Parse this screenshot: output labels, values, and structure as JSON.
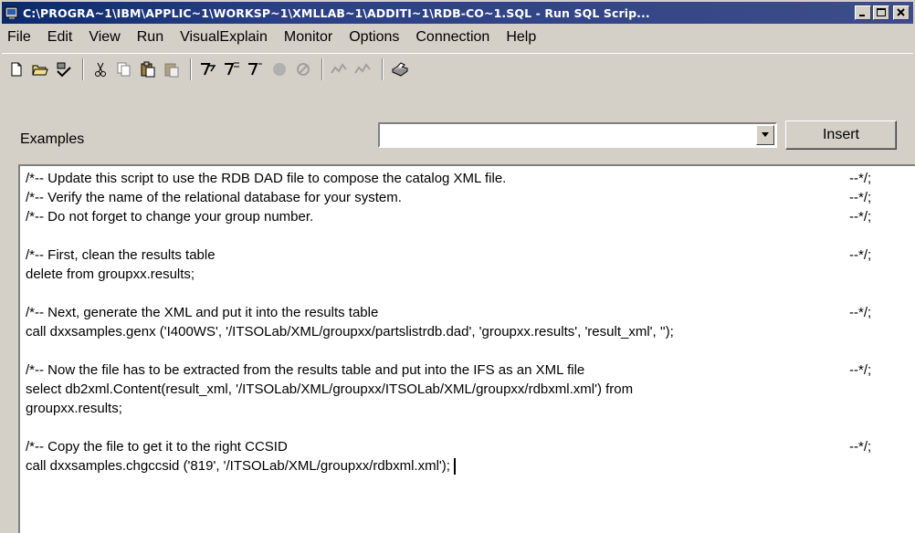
{
  "window": {
    "title": "C:\\PROGRA~1\\IBM\\APPLIC~1\\WORKSP~1\\XMLLAB~1\\ADDITI~1\\RDB-CO~1.SQL - Run SQL Scrip..."
  },
  "menu": [
    {
      "label": "File"
    },
    {
      "label": "Edit"
    },
    {
      "label": "View"
    },
    {
      "label": "Run"
    },
    {
      "label": "VisualExplain"
    },
    {
      "label": "Monitor"
    },
    {
      "label": "Options"
    },
    {
      "label": "Connection"
    },
    {
      "label": "Help"
    }
  ],
  "toolbar": {
    "icons": [
      "new-icon",
      "open-icon",
      "save-icon",
      "cut-icon",
      "copy-icon",
      "paste-icon",
      "paste-disabled-icon",
      "run-all-icon",
      "run-from-icon",
      "run-selected-icon",
      "stop-icon",
      "cancel-icon",
      "explain-icon",
      "explain-disabled-icon",
      "print-icon"
    ]
  },
  "examples": {
    "label": "Examples",
    "selected": "",
    "insert_label": "Insert"
  },
  "editor": {
    "lines": [
      {
        "text": "/*-- Update this script to use the RDB DAD file to compose the catalog XML file.",
        "end": "--*/;"
      },
      {
        "text": "/*-- Verify the name of the relational database for your system.",
        "end": "--*/;"
      },
      {
        "text": "/*-- Do not forget to change your group number.",
        "end": "--*/;"
      },
      {
        "text": "",
        "end": ""
      },
      {
        "text": "/*-- First, clean the results table",
        "end": "--*/;"
      },
      {
        "text": "delete from groupxx.results;",
        "end": ""
      },
      {
        "text": "",
        "end": ""
      },
      {
        "text": "/*-- Next, generate the XML and put it into the results table",
        "end": "--*/;"
      },
      {
        "text": "call dxxsamples.genx ('I400WS', '/ITSOLab/XML/groupxx/partslistrdb.dad', 'groupxx.results', 'result_xml', '');",
        "end": ""
      },
      {
        "text": "",
        "end": ""
      },
      {
        "text": "/*-- Now the file has to be extracted from the results table and put into the IFS as an XML file",
        "end": "--*/;"
      },
      {
        "text": "select db2xml.Content(result_xml, '/ITSOLab/XML/groupxx/ITSOLab/XML/groupxx/rdbxml.xml') from",
        "end": ""
      },
      {
        "text": "groupxx.results;",
        "end": ""
      },
      {
        "text": "",
        "end": ""
      },
      {
        "text": "/*-- Copy the file to get it to the right CCSID",
        "end": "--*/;"
      },
      {
        "text": "call dxxsamples.chgccsid ('819', '/ITSOLab/XML/groupxx/rdbxml.xml');",
        "end": ""
      }
    ]
  }
}
